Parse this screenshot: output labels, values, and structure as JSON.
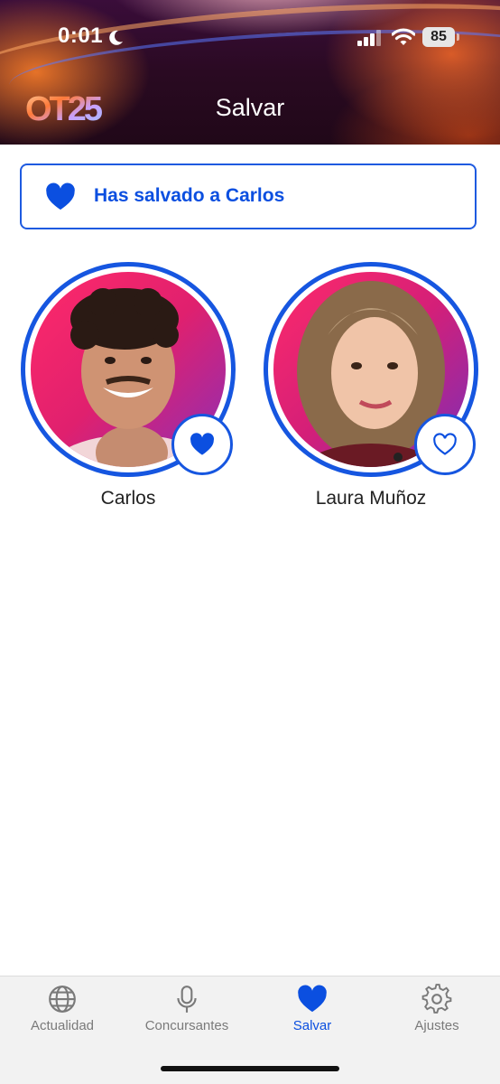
{
  "status_bar": {
    "time": "0:01",
    "battery": "85"
  },
  "header": {
    "logo_text": "OT25",
    "title": "Salvar"
  },
  "banner": {
    "text": "Has salvado a Carlos",
    "icon": "heart-filled-icon"
  },
  "contestants": [
    {
      "name": "Carlos",
      "saved": true,
      "heart_icon": "heart-filled-icon"
    },
    {
      "name": "Laura Muñoz",
      "saved": false,
      "heart_icon": "heart-outline-icon"
    }
  ],
  "tabbar": {
    "items": [
      {
        "label": "Actualidad",
        "icon": "globe-icon",
        "active": false
      },
      {
        "label": "Concursantes",
        "icon": "microphone-icon",
        "active": false
      },
      {
        "label": "Salvar",
        "icon": "heart-icon",
        "active": true
      },
      {
        "label": "Ajustes",
        "icon": "gear-icon",
        "active": false
      }
    ]
  },
  "colors": {
    "accent": "#0b4fe0",
    "ring": "#1656e0",
    "tab_inactive": "#7a7a7a"
  }
}
